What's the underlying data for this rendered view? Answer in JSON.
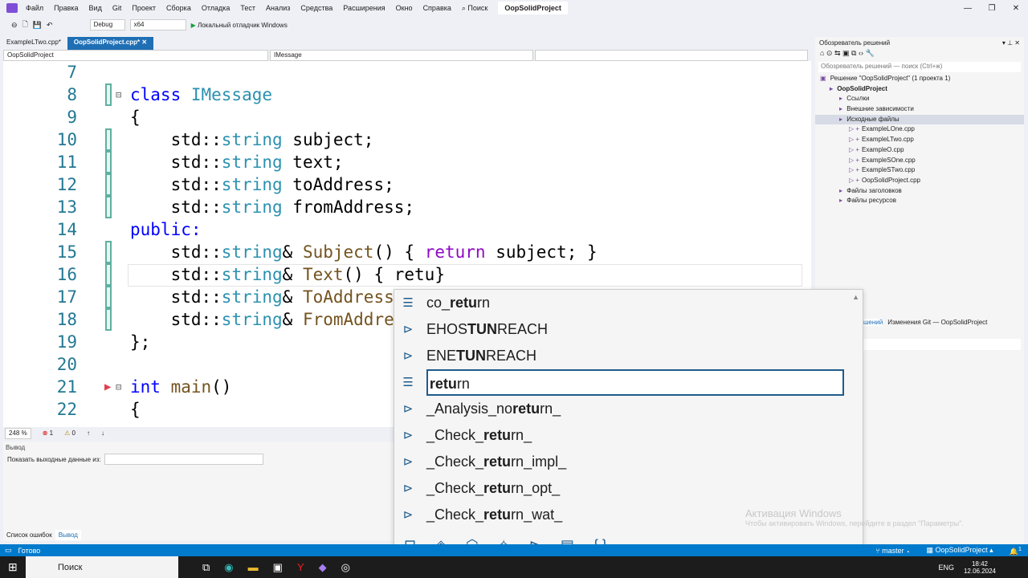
{
  "menu": {
    "items": [
      "Файл",
      "Правка",
      "Вид",
      "Git",
      "Проект",
      "Сборка",
      "Отладка",
      "Тест",
      "Анализ",
      "Средства",
      "Расширения",
      "Окно",
      "Справка"
    ],
    "search": "Поиск",
    "project": "OopSolidProject"
  },
  "toolbar": {
    "config": "Debug",
    "platform": "x64",
    "run": "Локальный отладчик Windows"
  },
  "tabs": [
    {
      "label": "ExampleLTwo.cpp*"
    },
    {
      "label": "OopSolidProject.cpp*"
    }
  ],
  "navbar": {
    "project": "OopSolidProject",
    "scope": "IMessage"
  },
  "editor": {
    "lines": [
      {
        "n": "7",
        "t": []
      },
      {
        "n": "8",
        "t": [
          [
            "class ",
            "kw"
          ],
          [
            "IMessage",
            "ty"
          ]
        ]
      },
      {
        "n": "9",
        "t": [
          [
            "{",
            "pl"
          ]
        ]
      },
      {
        "n": "10",
        "t": [
          [
            "    std::",
            "pl"
          ],
          [
            "string",
            "ty"
          ],
          [
            " subject;",
            "pl"
          ]
        ]
      },
      {
        "n": "11",
        "t": [
          [
            "    std::",
            "pl"
          ],
          [
            "string",
            "ty"
          ],
          [
            " text;",
            "pl"
          ]
        ]
      },
      {
        "n": "12",
        "t": [
          [
            "    std::",
            "pl"
          ],
          [
            "string",
            "ty"
          ],
          [
            " toAddress;",
            "pl"
          ]
        ]
      },
      {
        "n": "13",
        "t": [
          [
            "    std::",
            "pl"
          ],
          [
            "string",
            "ty"
          ],
          [
            " fromAddress;",
            "pl"
          ]
        ]
      },
      {
        "n": "14",
        "t": [
          [
            "public:",
            "kw"
          ]
        ]
      },
      {
        "n": "15",
        "t": [
          [
            "    std::",
            "pl"
          ],
          [
            "string",
            "ty"
          ],
          [
            "& ",
            "pl"
          ],
          [
            "Subject",
            "fn"
          ],
          [
            "() { ",
            "pl"
          ],
          [
            "return",
            "ctl"
          ],
          [
            " subject; }",
            "pl"
          ]
        ]
      },
      {
        "n": "16",
        "t": [
          [
            "    std::",
            "pl"
          ],
          [
            "string",
            "ty"
          ],
          [
            "& ",
            "pl"
          ],
          [
            "Text",
            "fn"
          ],
          [
            "() { ",
            "pl"
          ],
          [
            "retu}",
            "pl"
          ]
        ]
      },
      {
        "n": "17",
        "t": [
          [
            "    std::",
            "pl"
          ],
          [
            "string",
            "ty"
          ],
          [
            "& ",
            "pl"
          ],
          [
            "ToAddress",
            "fn"
          ]
        ]
      },
      {
        "n": "18",
        "t": [
          [
            "    std::",
            "pl"
          ],
          [
            "string",
            "ty"
          ],
          [
            "& ",
            "pl"
          ],
          [
            "FromAddre",
            "fn"
          ]
        ]
      },
      {
        "n": "19",
        "t": [
          [
            "};",
            "pl"
          ]
        ]
      },
      {
        "n": "20",
        "t": []
      },
      {
        "n": "21",
        "t": [
          [
            "int ",
            "kw"
          ],
          [
            "main",
            "fn"
          ],
          [
            "()",
            "pl"
          ]
        ]
      },
      {
        "n": "22",
        "t": [
          [
            "{",
            "pl"
          ]
        ]
      }
    ],
    "zoom": "248 %",
    "errors": "1",
    "warnings": "0"
  },
  "autocomplete": {
    "items": [
      {
        "label": "co_return",
        "icon": "keyword-icon"
      },
      {
        "label": "EHOSTUNREACH",
        "icon": "macro-icon"
      },
      {
        "label": "ENETUNREACH",
        "icon": "macro-icon"
      },
      {
        "label": "return",
        "icon": "keyword-icon",
        "selected": true
      },
      {
        "label": "_Analysis_noreturn_",
        "icon": "macro-icon"
      },
      {
        "label": "_Check_return_",
        "icon": "macro-icon"
      },
      {
        "label": "_Check_return_impl_",
        "icon": "macro-icon"
      },
      {
        "label": "_Check_return_opt_",
        "icon": "macro-icon"
      },
      {
        "label": "_Check_return_wat_",
        "icon": "macro-icon"
      }
    ],
    "filters": [
      "snippet",
      "class",
      "struct",
      "function",
      "macro",
      "enum",
      "namespace"
    ]
  },
  "output": {
    "title": "Вывод",
    "show_from": "Показать выходные данные из:",
    "tabs": [
      "Список ошибок",
      "Вывод"
    ]
  },
  "solution": {
    "title": "Обозреватель решений",
    "search": "Обозреватель решений — поиск (Ctrl+ж)",
    "tree": [
      {
        "label": "Решение \"OopSolidProject\" (1 проекта 1)",
        "depth": 0
      },
      {
        "label": "OopSolidProject",
        "depth": 1,
        "bold": true
      },
      {
        "label": "Ссылки",
        "depth": 2
      },
      {
        "label": "Внешние зависимости",
        "depth": 2
      },
      {
        "label": "Исходные файлы",
        "depth": 2,
        "selected": true
      },
      {
        "label": "ExampleLOne.cpp",
        "depth": 3
      },
      {
        "label": "ExampleLTwo.cpp",
        "depth": 3
      },
      {
        "label": "ExampleO.cpp",
        "depth": 3
      },
      {
        "label": "ExampleSOne.cpp",
        "depth": 3
      },
      {
        "label": "ExampleSTwo.cpp",
        "depth": 3
      },
      {
        "label": "OopSolidProject.cpp",
        "depth": 3
      },
      {
        "label": "Файлы заголовков",
        "depth": 2
      },
      {
        "label": "Файлы ресурсов",
        "depth": 2
      }
    ],
    "tab_short": "шений",
    "git_tab": "Изменения Git — OopSolidProject"
  },
  "status": {
    "ready": "Готово",
    "branch": "master",
    "repo": "OopSolidProject",
    "notifications": "1"
  },
  "taskbar": {
    "search": "Поиск",
    "time": "18:42",
    "date": "12.06.2024",
    "lang": "ENG"
  },
  "watermark": {
    "title": "Активация Windows",
    "text": "Чтобы активировать Windows, перейдите в раздел \"Параметры\"."
  }
}
